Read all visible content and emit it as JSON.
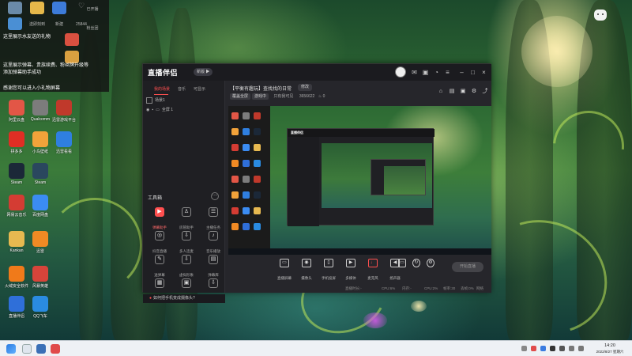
{
  "overlay": {
    "icons": [
      {
        "label": "",
        "icon": "recycle-bin-icon",
        "color": "#6a8aa8"
      },
      {
        "label": "",
        "icon": "folder-icon",
        "color": "#e6b84a"
      },
      {
        "label": "新建",
        "icon": "app-icon",
        "color": "#3d7bd9"
      },
      {
        "label": "25844",
        "icon": "heart-icon",
        "color": "#888888"
      },
      {
        "label": "已开播",
        "icon": "live-icon",
        "color": "#444444"
      },
      {
        "label": "",
        "icon": "app-icon",
        "color": "#4a8fd4"
      },
      {
        "label": "",
        "icon": "app-icon",
        "color": "#d95040"
      },
      {
        "label": "",
        "icon": "app-icon",
        "color": "#d9a040"
      }
    ],
    "row1_labels": [
      "",
      "送即刻到",
      "",
      "",
      "粉丝团"
    ],
    "notes": [
      "这里展示水友送的礼物",
      "这里展示弹幕、贵族续费、粉丝牌升级等",
      "添加弹幕助手成功",
      "感谢您可以进入小礼物屏幕"
    ]
  },
  "desktop_icons": [
    {
      "label": "阿里云盘",
      "icon": "app-icon",
      "color": "#e25646"
    },
    {
      "label": "Qualcomm",
      "icon": "game-icon",
      "color": "#7c7c7c"
    },
    {
      "label": "迅雷游戏平台",
      "icon": "game-icon",
      "color": "#c0392b"
    },
    {
      "label": "拼多多",
      "icon": "shop-icon",
      "color": "#e02e24"
    },
    {
      "label": "小鸟壁纸",
      "icon": "bird-icon",
      "color": "#f2a33a"
    },
    {
      "label": "迅雷看看",
      "icon": "play-icon",
      "color": "#2f7fe0"
    },
    {
      "label": "Steam",
      "icon": "steam-icon",
      "color": "#1b2838"
    },
    {
      "label": "Steam",
      "icon": "steam-icon",
      "color": "#2a475e"
    },
    {
      "label": "网易云音乐",
      "icon": "music-icon",
      "color": "#d43c33"
    },
    {
      "label": "百度网盘",
      "icon": "cloud-icon",
      "color": "#3b8cf2"
    },
    {
      "label": "Kankan",
      "icon": "folder-icon",
      "color": "#e7b950"
    },
    {
      "label": "迅雷",
      "icon": "app-icon",
      "color": "#f08a24"
    },
    {
      "label": "火绒安全软件",
      "icon": "shield-icon",
      "color": "#f07a1a"
    },
    {
      "label": "风暴英雄",
      "icon": "app-icon",
      "color": "#d7443a"
    },
    {
      "label": "直播伴侣",
      "icon": "app-icon",
      "color": "#2f6fd9"
    },
    {
      "label": "QQ飞车",
      "icon": "app-icon",
      "color": "#2a8be0"
    }
  ],
  "app": {
    "brand": "直播伴侣",
    "brand_badge": "新版 ▶",
    "tabs": [
      "我的场景",
      "音乐",
      "可显示"
    ],
    "scenes": [
      {
        "label": "场景1"
      },
      {
        "label": "全屏 1"
      }
    ],
    "tools_title": "工具箱",
    "tools": [
      {
        "label": "弹幕助手",
        "icon": "bullet-icon"
      },
      {
        "label": "房管助手",
        "icon": "admin-icon"
      },
      {
        "label": "主播任务",
        "icon": "task-icon"
      },
      {
        "label": "抖音直播",
        "icon": "live-icon"
      },
      {
        "label": "多人连麦",
        "icon": "mic-icon"
      },
      {
        "label": "音乐播放",
        "icon": "music-icon"
      },
      {
        "label": "送弹幕",
        "icon": "send-icon"
      },
      {
        "label": "虚拟形象",
        "icon": "avatar-icon"
      },
      {
        "label": "弹幕库",
        "icon": "library-icon"
      },
      {
        "label": "",
        "icon": "calendar-icon"
      },
      {
        "label": "",
        "icon": "grid-icon"
      },
      {
        "label": "",
        "icon": "download-icon"
      }
    ],
    "notice": "如何把手机变成摄像头?",
    "room_title": "【平衡有趣玩】查找找的日常",
    "edit_label": "修改",
    "meta": [
      "覆盖全屏",
      "游戏中",
      "只有我可见",
      "3656622",
      "0"
    ],
    "controls": [
      {
        "label": "直播屏幕",
        "icon": "screen-icon"
      },
      {
        "label": "摄像头",
        "icon": "camera-icon"
      },
      {
        "label": "手机投屏",
        "icon": "phone-icon"
      },
      {
        "label": "多媒体",
        "icon": "media-icon"
      },
      {
        "label": "麦克风",
        "icon": "microphone-icon"
      },
      {
        "label": "扬声器",
        "icon": "speaker-icon"
      }
    ],
    "start_label": "开始直播",
    "status": [
      "直播时长:-",
      "CPU:6%",
      "内存:-",
      "CPU:2%",
      "帧率:30",
      "丢帧:0%",
      "网络"
    ]
  },
  "taskbar": {
    "clock_time": "14:20",
    "clock_date": "2022/8/27 星期六"
  }
}
